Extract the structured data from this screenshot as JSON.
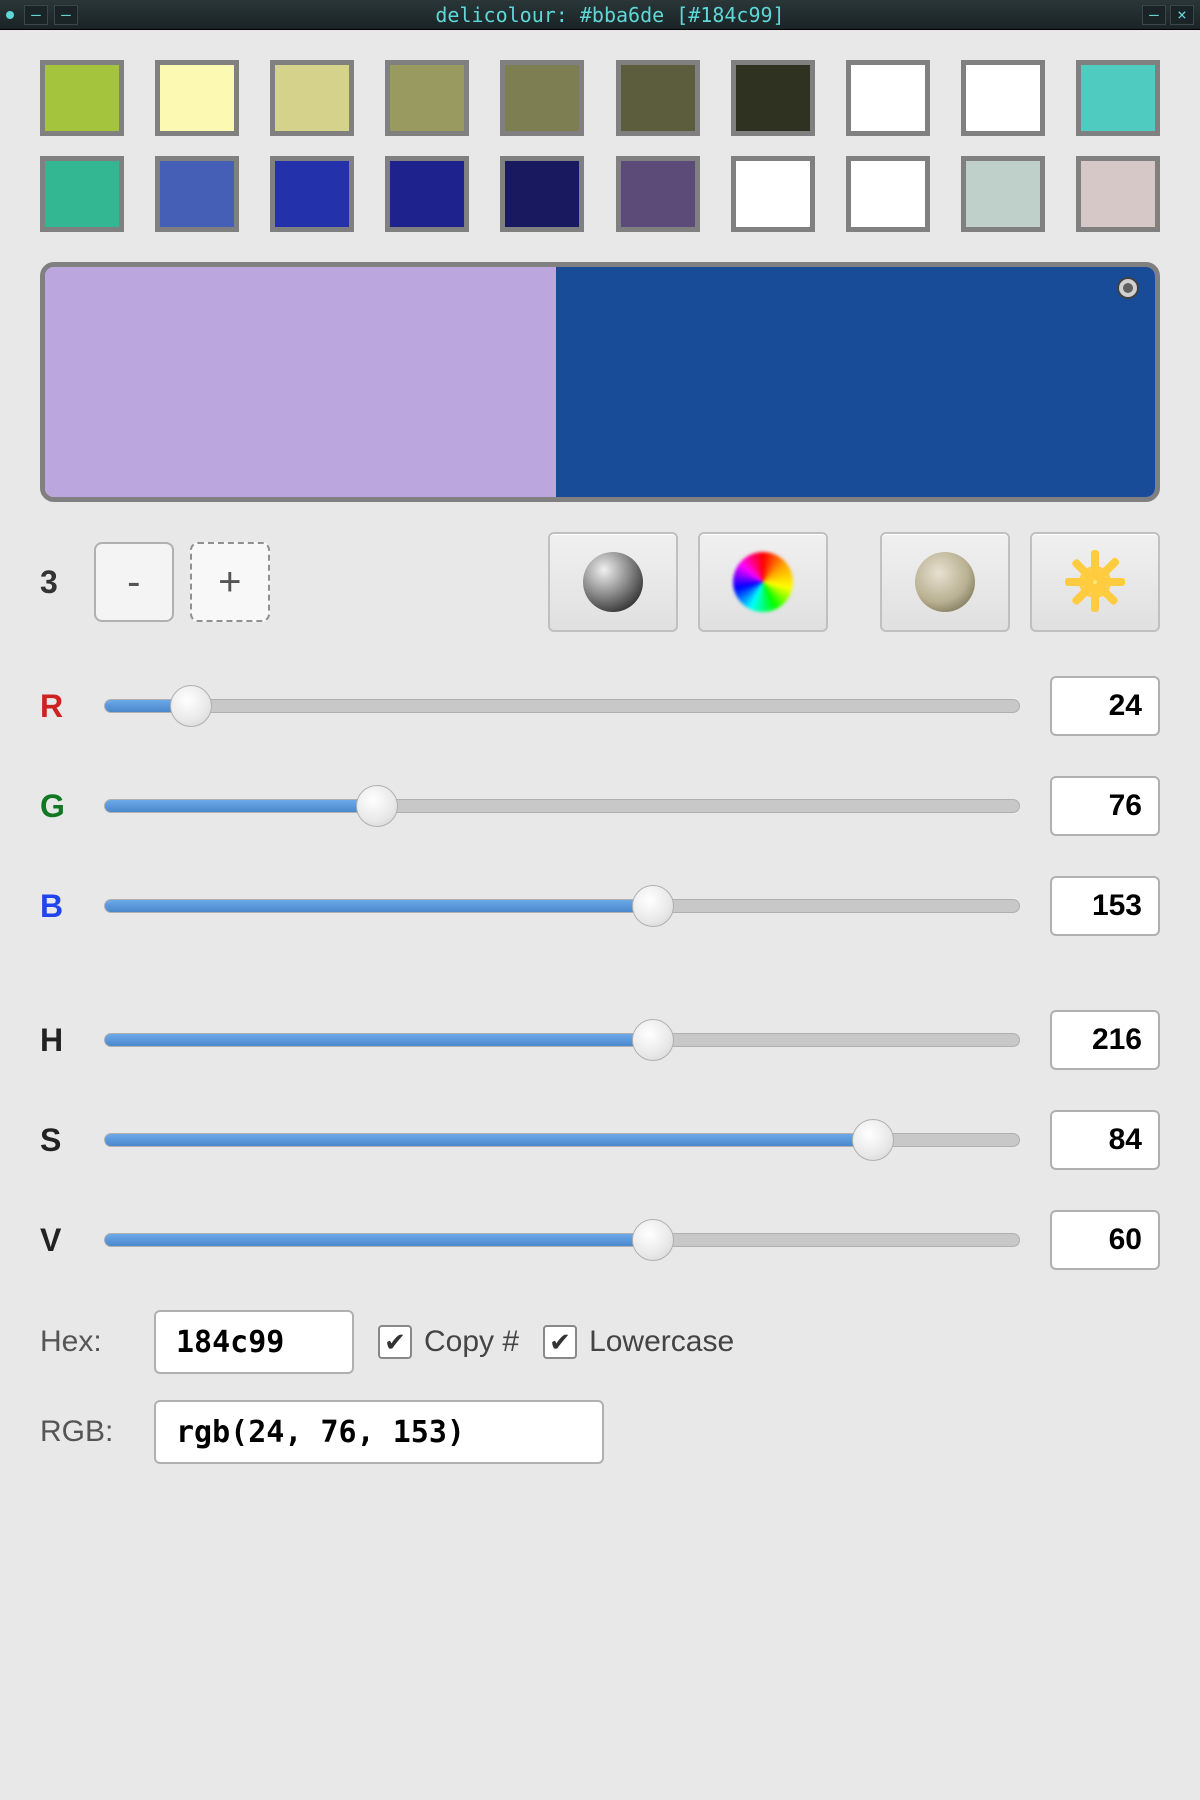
{
  "window": {
    "title": "delicolour: #bba6de [#184c99]"
  },
  "palette": {
    "row1": [
      "#a4c43e",
      "#fbf9b2",
      "#d5d28b",
      "#999a5f",
      "#7d7e51",
      "#5b5d3d",
      "#2f3220",
      "#ffffff",
      "#ffffff",
      "#4fcbc0"
    ],
    "row2": [
      "#33b792",
      "#465fb6",
      "#2332aa",
      "#1e228c",
      "#18195f",
      "#5c4b79",
      "#ffffff",
      "#ffffff",
      "#bfd0cb",
      "#d5c8c6"
    ]
  },
  "compare": {
    "left_color": "#bba6de",
    "right_color": "#184c99"
  },
  "step": {
    "value": "3",
    "minus": "-",
    "plus": "+"
  },
  "sliders": {
    "r": {
      "label": "R",
      "value": "24",
      "max": 255
    },
    "g": {
      "label": "G",
      "value": "76",
      "max": 255
    },
    "b": {
      "label": "B",
      "value": "153",
      "max": 255
    },
    "h": {
      "label": "H",
      "value": "216",
      "max": 360
    },
    "s": {
      "label": "S",
      "value": "84",
      "max": 100
    },
    "v": {
      "label": "V",
      "value": "60",
      "max": 100
    }
  },
  "output": {
    "hex_label": "Hex:",
    "hex_value": "184c99",
    "rgb_label": "RGB:",
    "rgb_value": "rgb(24, 76, 153)",
    "copy_hash_label": "Copy #",
    "copy_hash_checked": true,
    "lowercase_label": "Lowercase",
    "lowercase_checked": true
  }
}
